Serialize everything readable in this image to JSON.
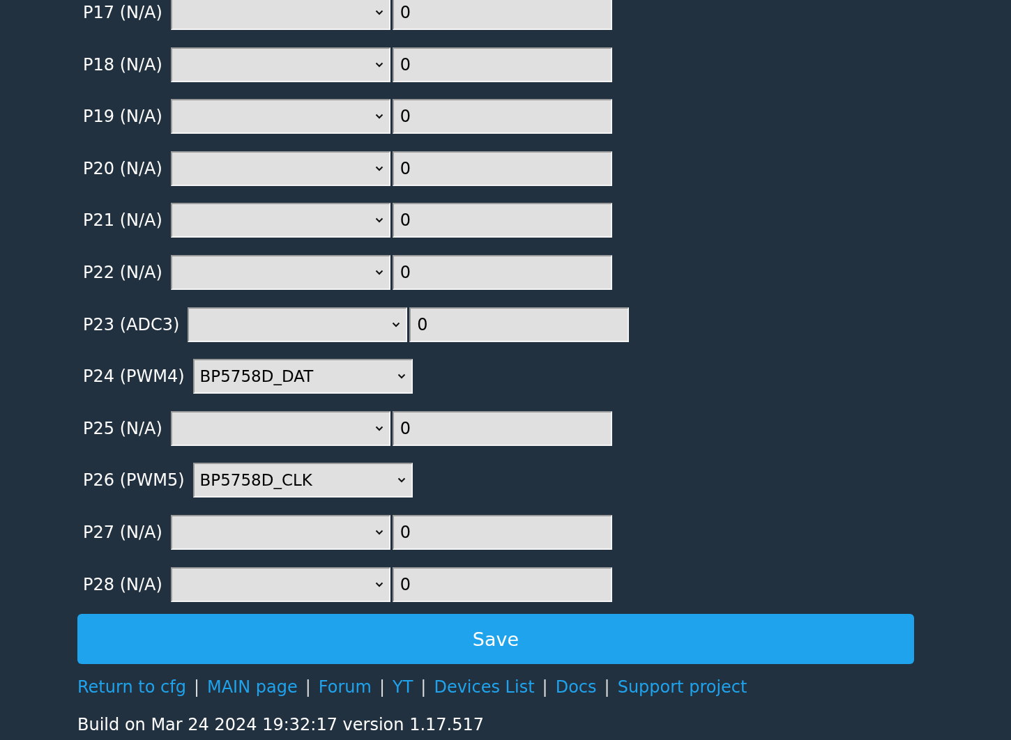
{
  "pins": [
    {
      "label": "P17 (N/A)",
      "input": "0"
    },
    {
      "label": "P18 (N/A)",
      "input": "0"
    },
    {
      "label": "P19 (N/A)",
      "input": "0"
    },
    {
      "label": "P20 (N/A)",
      "input": "0"
    },
    {
      "label": "P21 (N/A)",
      "input": "0"
    },
    {
      "label": "P22 (N/A)",
      "input": "0"
    },
    {
      "label": "P23 (ADC3)",
      "input": "0"
    },
    {
      "label": "P24 (PWM4)",
      "role": "BP5758D_DAT"
    },
    {
      "label": "P25 (N/A)",
      "input": "0"
    },
    {
      "label": "P26 (PWM5)",
      "role": "BP5758D_CLK"
    },
    {
      "label": "P27 (N/A)",
      "input": "0"
    },
    {
      "label": "P28 (N/A)",
      "input": "0"
    }
  ],
  "save_button": "Save",
  "links": [
    "Return to cfg",
    "MAIN page",
    "Forum",
    "YT",
    "Devices List",
    "Docs",
    "Support project"
  ],
  "separator": "|",
  "build": "Build on Mar 24 2024 19:32:17 version 1.17.517"
}
